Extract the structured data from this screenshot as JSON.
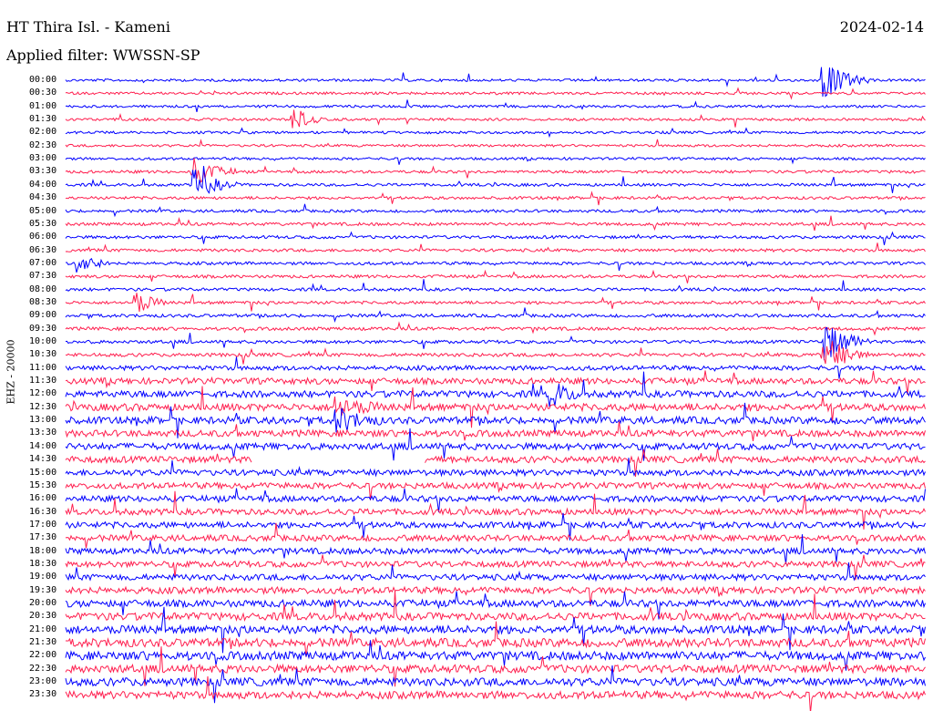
{
  "header": {
    "title": "HT Thira Isl. - Kameni",
    "filter": "Applied filter: WWSSN-SP",
    "date": "2024-02-14"
  },
  "station_label": "EHZ - 20000",
  "colors": {
    "trace_a": "#0000ff",
    "trace_b": "#ff1f4f",
    "background": "#ffffff"
  },
  "chart_data": {
    "type": "line",
    "title": "HT Thira Isl. - Kameni",
    "subtitle": "Applied filter: WWSSN-SP",
    "ylabel": "EHZ - 20000",
    "row_labels": [
      "00:00",
      "00:30",
      "01:00",
      "01:30",
      "02:00",
      "02:30",
      "03:00",
      "03:30",
      "04:00",
      "04:30",
      "05:00",
      "05:30",
      "06:00",
      "06:30",
      "07:00",
      "07:30",
      "08:00",
      "08:30",
      "09:00",
      "09:30",
      "10:00",
      "10:30",
      "11:00",
      "11:30",
      "12:00",
      "12:30",
      "13:00",
      "13:30",
      "14:00",
      "14:30",
      "15:00",
      "15:30",
      "16:00",
      "16:30",
      "17:00",
      "17:30",
      "18:00",
      "18:30",
      "19:00",
      "19:30",
      "20:00",
      "20:30",
      "21:00",
      "21:30",
      "22:00",
      "22:30",
      "23:00",
      "23:30"
    ],
    "row_colors": [
      "trace_a",
      "trace_b"
    ],
    "rows_per_hour": 2,
    "minutes_per_row": 30,
    "noise_level": [
      0.25,
      0.25,
      0.25,
      0.25,
      0.25,
      0.25,
      0.25,
      0.28,
      0.28,
      0.28,
      0.28,
      0.3,
      0.3,
      0.3,
      0.3,
      0.3,
      0.3,
      0.3,
      0.32,
      0.32,
      0.32,
      0.35,
      0.45,
      0.6,
      0.65,
      0.7,
      0.7,
      0.65,
      0.65,
      0.65,
      0.6,
      0.6,
      0.6,
      0.6,
      0.6,
      0.6,
      0.6,
      0.6,
      0.6,
      0.65,
      0.7,
      0.75,
      0.8,
      0.85,
      0.85,
      0.8,
      0.8,
      0.75
    ],
    "events": [
      {
        "row": 0,
        "minute": 26.5,
        "amplitude": 2.2,
        "duration": 1.5
      },
      {
        "row": 3,
        "minute": 8,
        "amplitude": 1.4,
        "duration": 1
      },
      {
        "row": 7,
        "minute": 4.5,
        "amplitude": 1.6,
        "duration": 1.5
      },
      {
        "row": 8,
        "minute": 4.5,
        "amplitude": 1.8,
        "duration": 1.5
      },
      {
        "row": 14,
        "minute": 0.5,
        "amplitude": 1.4,
        "duration": 1
      },
      {
        "row": 17,
        "minute": 2.5,
        "amplitude": 1.4,
        "duration": 1
      },
      {
        "row": 20,
        "minute": 26.5,
        "amplitude": 2.5,
        "duration": 1.5
      },
      {
        "row": 21,
        "minute": 26.5,
        "amplitude": 2.2,
        "duration": 1.5
      },
      {
        "row": 24,
        "minute": 17,
        "amplitude": 1.5,
        "duration": 1
      },
      {
        "row": 25,
        "minute": 9.5,
        "amplitude": 1.3,
        "duration": 1.5
      },
      {
        "row": 26,
        "minute": 9.5,
        "amplitude": 1.4,
        "duration": 1.5
      }
    ],
    "gaps": [
      {
        "row": 29,
        "start_minute": 6.5,
        "end_minute": 12.5
      }
    ],
    "xlim_minutes": [
      0,
      30
    ]
  }
}
